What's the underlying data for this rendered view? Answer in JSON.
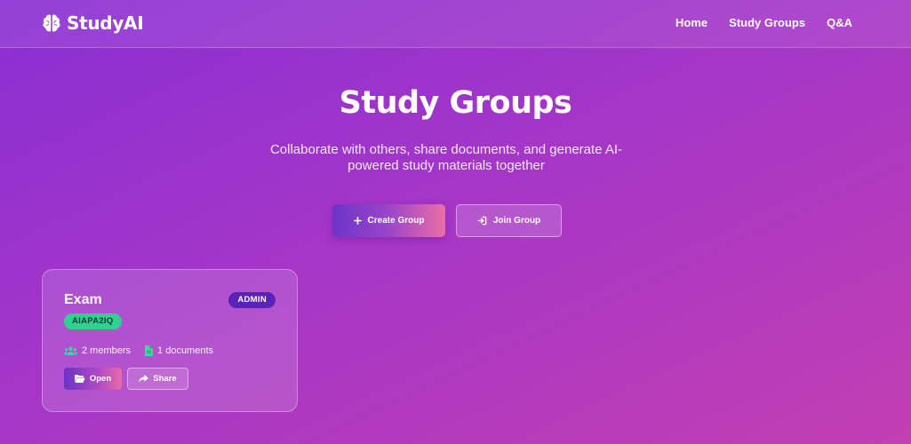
{
  "nav": {
    "brand": "StudyAI",
    "brand_icon": "brain-icon",
    "links": [
      "Home",
      "Study Groups",
      "Q&A"
    ]
  },
  "hero": {
    "title": "Study Groups",
    "subtitle": "Collaborate with others, share documents, and generate AI-powered study materials together",
    "create_label": "Create Group",
    "create_icon": "plus-icon",
    "join_label": "Join Group",
    "join_icon": "sign-in-icon"
  },
  "groups": [
    {
      "name": "Exam",
      "role": "ADMIN",
      "code": "AIAPA2IQ",
      "members": "2 members",
      "documents": "1 documents",
      "open_label": "Open",
      "share_label": "Share"
    }
  ],
  "colors": {
    "background_start": "#8a2fd3",
    "background_end": "#c23fb2",
    "admin_badge": "#5b22b8",
    "code_badge": "#2fd18f"
  }
}
